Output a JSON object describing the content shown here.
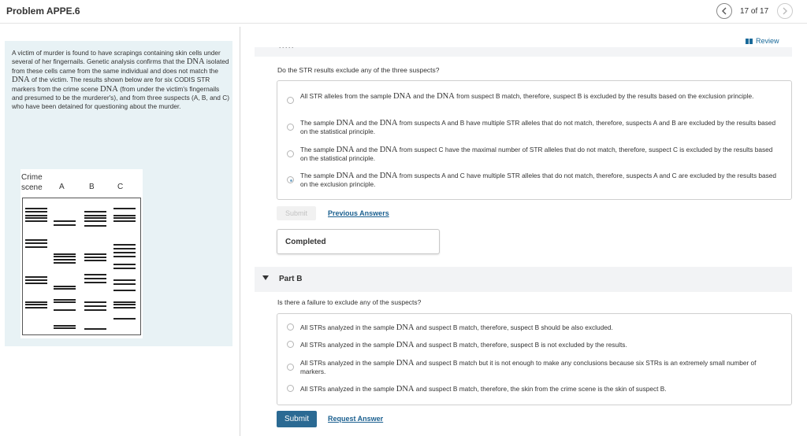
{
  "header": {
    "title": "Problem APPE.6",
    "page_counter": "17 of 17",
    "prev_icon": "chevron-left-icon",
    "next_icon": "chevron-right-icon"
  },
  "problem": {
    "text_segments": [
      "A victim of murder is found to have scrapings containing skin cells under several of her fingernails. Genetic analysis confirms that the ",
      "DNA",
      " isolated from these cells came from the same individual and does not match the ",
      "DNA",
      " of the victim. The results shown below are for six CODIS STR markers from the crime scene ",
      "DNA",
      " (from under the victim's fingernails and presumed to be the murderer's), and from three suspects (A, B, and C) who have been detained for questioning about the murder."
    ],
    "gel": {
      "lane_labels": [
        "Crime\nscene",
        "A",
        "B",
        "C"
      ]
    }
  },
  "review": {
    "label": "Review",
    "icon": "review-icon"
  },
  "part_a": {
    "strip_text": "·····",
    "question": "Do the STR results exclude any of the three suspects?",
    "choices": [
      {
        "segments": [
          "All STR alleles from the sample ",
          "DNA",
          " and the ",
          "DNA",
          " from suspect B match, therefore, suspect B is excluded by the results based on the exclusion principle."
        ],
        "selected": false
      },
      {
        "segments": [
          "The sample ",
          "DNA",
          " and the ",
          "DNA",
          " from suspects A and B have multiple STR alleles that do not match, therefore, suspects A and B are excluded by the results based on the statistical principle."
        ],
        "selected": false
      },
      {
        "segments": [
          "The sample ",
          "DNA",
          " and the ",
          "DNA",
          " from suspect C have the maximal number of STR alleles that do not match, therefore, suspect C is excluded by the results based on the statistical principle."
        ],
        "selected": false
      },
      {
        "segments": [
          "The sample ",
          "DNA",
          " and the ",
          "DNA",
          " from suspects A and C have multiple STR alleles that do not match, therefore, suspects A and C are excluded by the results based on the exclusion principle."
        ],
        "selected": true
      }
    ],
    "submit_label": "Submit",
    "previous_answers_label": "Previous Answers",
    "completed_label": "Completed"
  },
  "part_b": {
    "label": "Part B",
    "question": "Is there a failure to exclude any of the suspects?",
    "choices": [
      {
        "segments": [
          "All STRs analyzed in the sample ",
          "DNA",
          " and suspect B match, therefore, suspect B should be also excluded."
        ],
        "selected": false
      },
      {
        "segments": [
          "All STRs analyzed in the sample ",
          "DNA",
          " and suspect B match, therefore, suspect B is not excluded by the results."
        ],
        "selected": false
      },
      {
        "segments": [
          "All STRs analyzed in the sample ",
          "DNA",
          " and suspect B match but it is not enough to make any conclusions because six STRs is an extremely small number of markers."
        ],
        "selected": false
      },
      {
        "segments": [
          "All STRs analyzed in the sample ",
          "DNA",
          " and suspect B match, therefore, the skin from the crime scene is the skin of suspect B."
        ],
        "selected": false
      }
    ],
    "submit_label": "Submit",
    "request_answer_label": "Request Answer"
  }
}
